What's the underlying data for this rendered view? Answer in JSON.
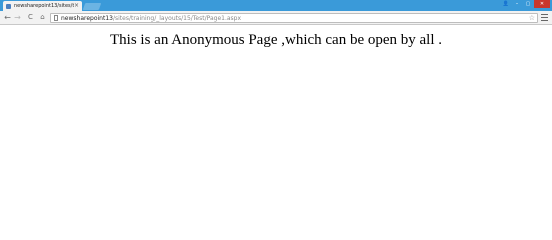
{
  "tab": {
    "title": "newsharepoint13/sites/tra",
    "close_glyph": "×"
  },
  "window": {
    "user_glyph": "👤",
    "minimize_glyph": "–",
    "restore_glyph": "▢",
    "close_glyph": "✕"
  },
  "toolbar": {
    "back_glyph": "←",
    "forward_glyph": "→",
    "reload_glyph": "C",
    "home_glyph": "⌂",
    "url_host": "newsharepoint13",
    "url_path": "/sites/training/_layouts/15/Test/Page1.aspx",
    "star_glyph": "☆"
  },
  "page": {
    "heading": "This is an Anonymous Page ,which can be open by all ."
  },
  "colors": {
    "titlebar": "#3a9ad9",
    "close_button": "#c8372d"
  }
}
